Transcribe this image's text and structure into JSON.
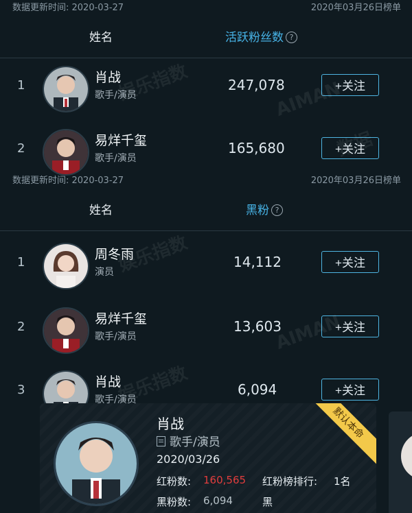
{
  "sections": [
    {
      "update_label": "数据更新时间: 2020-03-27",
      "board_date": "2020年03月26日榜单",
      "col_name": "姓名",
      "col_metric": "活跃粉丝数",
      "rows": [
        {
          "rank": "1",
          "name": "肖战",
          "role": "歌手/演员",
          "value": "247,078",
          "follow": "+关注"
        },
        {
          "rank": "2",
          "name": "易烊千玺",
          "role": "歌手/演员",
          "value": "165,680",
          "follow": "+关注"
        }
      ]
    },
    {
      "update_label": "数据更新时间: 2020-03-27",
      "board_date": "2020年03月26日榜单",
      "col_name": "姓名",
      "col_metric": "黑粉",
      "rows": [
        {
          "rank": "1",
          "name": "周冬雨",
          "role": "演员",
          "value": "14,112",
          "follow": "+关注"
        },
        {
          "rank": "2",
          "name": "易烊千玺",
          "role": "歌手/演员",
          "value": "13,603",
          "follow": "+关注"
        },
        {
          "rank": "3",
          "name": "肖战",
          "role": "歌手/演员",
          "value": "6,094",
          "follow": "+关注"
        }
      ]
    }
  ],
  "card": {
    "name": "肖战",
    "role": "歌手/演员",
    "date": "2020/03/26",
    "red_label": "红粉数:",
    "red_value": "160,565",
    "rank_label": "红粉榜排行:",
    "rank_value": "1名",
    "black_label": "黑粉数:",
    "black_value": "6,094",
    "cut_label": "黑",
    "ribbon": "默认本命"
  },
  "watermarks": [
    "娱乐指数",
    "AIMAN",
    "数据"
  ],
  "colors": {
    "accent": "#47b3e6",
    "red": "#e23d3d",
    "gold": "#f3c94a",
    "bg": "#0f1a20"
  }
}
